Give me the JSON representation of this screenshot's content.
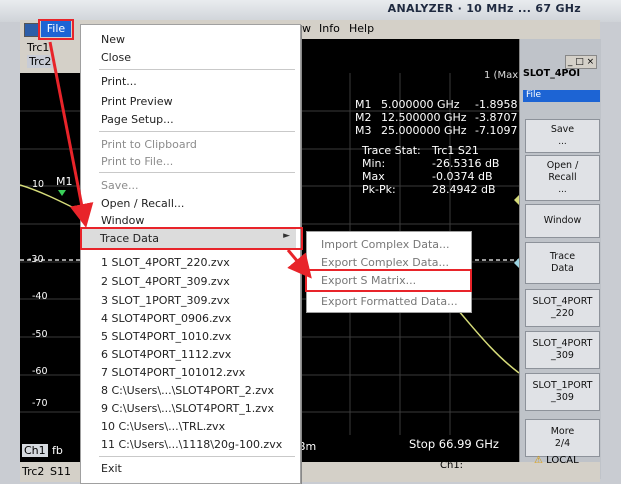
{
  "header": {
    "title": "ANALYZER  ·  10 MHz ... 67 GHz"
  },
  "menubar": {
    "file": "File",
    "info": "Info",
    "help": "Help",
    "partial": "w"
  },
  "traces": {
    "trc1": "Trc1",
    "trc2": "Trc2",
    "s": "S21"
  },
  "plot": {
    "max_label": "1 (Max)",
    "markers": [
      {
        "name": "M1",
        "freq": "5.000000 GHz",
        "val": "-1.8958 dB"
      },
      {
        "name": "M2",
        "freq": "12.500000 GHz",
        "val": "-3.8707 dB"
      },
      {
        "name": "M3",
        "freq": "25.000000 GHz",
        "val": "-7.1097 dB"
      }
    ],
    "stat_title": "Trace Stat:",
    "stat_trace": "Trc1 S21",
    "stats": [
      {
        "k": "Min:",
        "v": "-26.5316 dB"
      },
      {
        "k": "Max",
        "v": "-0.0374 dB"
      },
      {
        "k": "Pk-Pk:",
        "v": "28.4942 dB"
      }
    ],
    "y_labels": [
      "10",
      "-30",
      "-40",
      "-50",
      "-60",
      "-70"
    ],
    "m1_label": "M1",
    "stop": "Stop  66.99 GHz",
    "bm": "Bm",
    "ch1": "Ch1",
    "fb": "fb"
  },
  "right_panel": {
    "title": "SLOT_4POI",
    "file": "File",
    "softkeys": [
      {
        "label": "Save",
        "sub": "..."
      },
      {
        "label": "Open /\nRecall",
        "sub": "..."
      },
      {
        "label": "Window",
        "sub": ""
      },
      {
        "label": "Trace\nData",
        "sub": ""
      },
      {
        "label": "SLOT_4PORT\n_220",
        "sub": ""
      },
      {
        "label": "SLOT_4PORT\n_309",
        "sub": ""
      },
      {
        "label": "SLOT_1PORT\n_309",
        "sub": ""
      },
      {
        "label": "More\n2/4",
        "sub": ""
      }
    ]
  },
  "file_menu": {
    "items": [
      {
        "label": "New",
        "disabled": false
      },
      {
        "label": "Close",
        "disabled": false
      },
      {
        "label": "Print...",
        "disabled": false
      },
      {
        "label": "Print Preview",
        "disabled": false
      },
      {
        "label": "Page Setup...",
        "disabled": false
      },
      {
        "label": "Print to Clipboard",
        "disabled": true
      },
      {
        "label": "Print to File...",
        "disabled": true
      },
      {
        "label": "Save...",
        "disabled": true
      },
      {
        "label": "Open / Recall...",
        "disabled": false
      },
      {
        "label": "Window",
        "disabled": false
      },
      {
        "label": "Trace Data",
        "disabled": false
      },
      {
        "label": "1 SLOT_4PORT_220.zvx",
        "disabled": false
      },
      {
        "label": "2 SLOT_4PORT_309.zvx",
        "disabled": false
      },
      {
        "label": "3 SLOT_1PORT_309.zvx",
        "disabled": false
      },
      {
        "label": "4 SLOT4PORT_0906.zvx",
        "disabled": false
      },
      {
        "label": "5 SLOT4PORT_1010.zvx",
        "disabled": false
      },
      {
        "label": "6 SLOT4PORT_1112.zvx",
        "disabled": false
      },
      {
        "label": "7 SLOT4PORT_101012.zvx",
        "disabled": false
      },
      {
        "label": "8 C:\\Users\\...\\SLOT4PORT_2.zvx",
        "disabled": false
      },
      {
        "label": "9 C:\\Users\\...\\SLOT4PORT_1.zvx",
        "disabled": false
      },
      {
        "label": "10 C:\\Users\\...\\TRL.zvx",
        "disabled": false
      },
      {
        "label": "11 C:\\Users\\...\\1118\\20g-100.zvx",
        "disabled": false
      },
      {
        "label": "Exit",
        "disabled": false
      }
    ]
  },
  "submenu": {
    "items": [
      "Import Complex Data...",
      "Export Complex Data...",
      "Export S Matrix...",
      "Export Formatted Data..."
    ]
  },
  "status": {
    "ch1": "Ch1:",
    "local": "LOCAL",
    "trc2": "Trc2",
    "s11": "S11"
  },
  "colors": {
    "highlight": "#e8242a",
    "accent": "#1d64d4"
  }
}
